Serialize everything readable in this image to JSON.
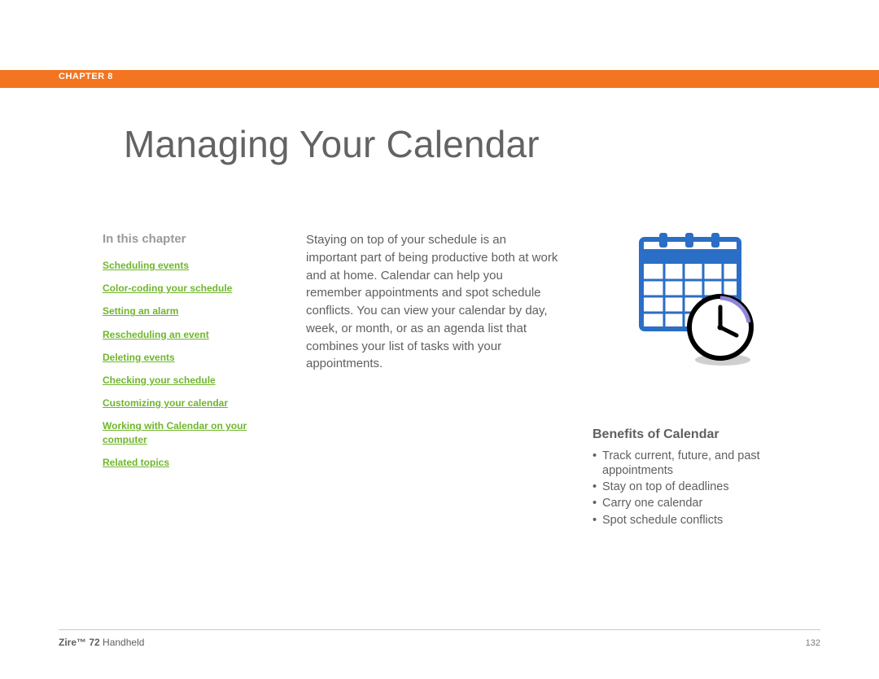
{
  "chapter": {
    "label": "CHAPTER 8"
  },
  "title": "Managing Your Calendar",
  "sidebar": {
    "heading": "In this chapter",
    "links": [
      "Scheduling events",
      "Color-coding your schedule",
      "Setting an alarm",
      "Rescheduling an event",
      "Deleting events",
      "Checking your schedule",
      "Customizing your calendar",
      "Working with Calendar on your computer",
      "Related topics"
    ]
  },
  "intro": "Staying on top of your schedule is an important part of being productive both at work and at home. Calendar can help you remember appointments and spot schedule conflicts. You can view your calendar by day, week, or month, or as an agenda list that combines your list of tasks with your appointments.",
  "benefits": {
    "heading": "Benefits of Calendar",
    "items": [
      "Track current, future, and past appointments",
      "Stay on top of deadlines",
      "Carry one calendar",
      "Spot schedule conflicts"
    ]
  },
  "footer": {
    "product_bold": "Zire™ 72",
    "product_rest": " Handheld",
    "page_number": "132"
  },
  "illustration": {
    "name": "calendar-clock-icon",
    "colors": {
      "frame": "#2b6ec5",
      "ring": "#000000",
      "face": "#ffffff",
      "accent": "#8f86d8"
    }
  }
}
